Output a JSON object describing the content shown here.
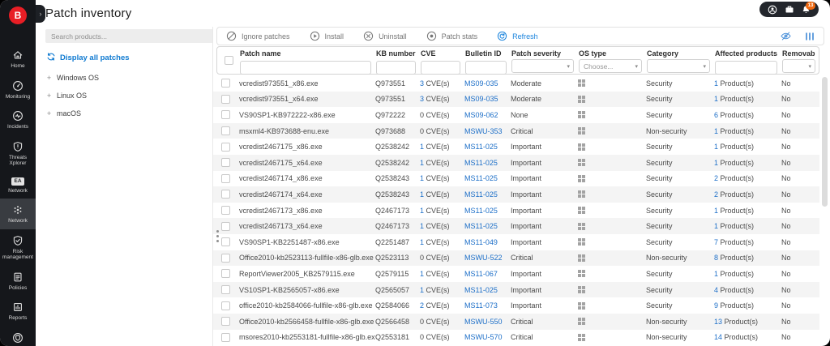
{
  "window": {
    "title": "Patch inventory"
  },
  "topbar": {
    "account_icons": [
      {
        "icon": "user-icon"
      },
      {
        "icon": "company-icon"
      },
      {
        "icon": "notifications-icon",
        "badge": "13"
      }
    ]
  },
  "sidebar": {
    "items": [
      {
        "label": "Home",
        "icon": "home-icon",
        "selected": false
      },
      {
        "label": "Monitoring",
        "icon": "monitoring-icon",
        "selected": false
      },
      {
        "label": "Incidents",
        "icon": "incidents-icon",
        "selected": false
      },
      {
        "label": "Threats Xplorer",
        "icon": "threats-xplorer-icon",
        "selected": false
      },
      {
        "label": "Network",
        "icon": "network-ea-icon",
        "selected": false
      },
      {
        "label": "Network",
        "icon": "network-icon",
        "selected": true
      },
      {
        "label": "Risk management",
        "icon": "risk-management-icon",
        "selected": false
      },
      {
        "label": "Policies",
        "icon": "policies-icon",
        "selected": false
      },
      {
        "label": "Reports",
        "icon": "reports-icon",
        "selected": false
      },
      {
        "label": "",
        "icon": "sandbox-icon",
        "selected": false
      }
    ]
  },
  "left_panel": {
    "search_placeholder": "Search products...",
    "display_all_label": "Display all patches",
    "tree": [
      {
        "label": "Windows OS"
      },
      {
        "label": "Linux OS"
      },
      {
        "label": "macOS"
      }
    ]
  },
  "toolbar": {
    "buttons": [
      {
        "label": "Ignore patches",
        "icon": "ignore-patches-icon",
        "accent": false
      },
      {
        "label": "Install",
        "icon": "install-icon",
        "accent": false
      },
      {
        "label": "Uninstall",
        "icon": "uninstall-icon",
        "accent": false
      },
      {
        "label": "Patch stats",
        "icon": "patch-stats-icon",
        "accent": false
      },
      {
        "label": "Refresh",
        "icon": "refresh-icon",
        "accent": true
      }
    ],
    "right_icons": [
      {
        "icon": "hide-columns-icon"
      },
      {
        "icon": "columns-icon"
      }
    ]
  },
  "table": {
    "columns": [
      {
        "label": "Patch name",
        "filter": "text",
        "placeholder": ""
      },
      {
        "label": "KB number",
        "filter": "text",
        "placeholder": ""
      },
      {
        "label": "CVE",
        "filter": "text",
        "placeholder": ""
      },
      {
        "label": "Bulletin ID",
        "filter": "text",
        "placeholder": ""
      },
      {
        "label": "Patch severity",
        "filter": "select",
        "placeholder": ""
      },
      {
        "label": "OS type",
        "filter": "select",
        "placeholder": "Choose..."
      },
      {
        "label": "Category",
        "filter": "select",
        "placeholder": ""
      },
      {
        "label": "Affected products",
        "filter": "text",
        "placeholder": ""
      },
      {
        "label": "Removable",
        "filter": "select",
        "placeholder": ""
      }
    ],
    "cve_suffix": "CVE(s)",
    "products_suffix": "Product(s)",
    "rows": [
      {
        "name": "vcredist973551_x86.exe",
        "kb": "Q973551",
        "cve": 3,
        "bulletin": "MS09-035",
        "severity": "Moderate",
        "os": "windows-icon",
        "category": "Security",
        "products": 1,
        "removable": "No"
      },
      {
        "name": "vcredist973551_x64.exe",
        "kb": "Q973551",
        "cve": 3,
        "bulletin": "MS09-035",
        "severity": "Moderate",
        "os": "windows-icon",
        "category": "Security",
        "products": 1,
        "removable": "No"
      },
      {
        "name": "VS90SP1-KB972222-x86.exe",
        "kb": "Q972222",
        "cve": 0,
        "bulletin": "MS09-062",
        "severity": "None",
        "os": "windows-icon",
        "category": "Security",
        "products": 6,
        "removable": "No"
      },
      {
        "name": "msxml4-KB973688-enu.exe",
        "kb": "Q973688",
        "cve": 0,
        "bulletin": "MSWU-353",
        "severity": "Critical",
        "os": "windows-icon",
        "category": "Non-security",
        "products": 1,
        "removable": "No"
      },
      {
        "name": "vcredist2467175_x86.exe",
        "kb": "Q2538242",
        "cve": 1,
        "bulletin": "MS11-025",
        "severity": "Important",
        "os": "windows-icon",
        "category": "Security",
        "products": 1,
        "removable": "No"
      },
      {
        "name": "vcredist2467175_x64.exe",
        "kb": "Q2538242",
        "cve": 1,
        "bulletin": "MS11-025",
        "severity": "Important",
        "os": "windows-icon",
        "category": "Security",
        "products": 1,
        "removable": "No"
      },
      {
        "name": "vcredist2467174_x86.exe",
        "kb": "Q2538243",
        "cve": 1,
        "bulletin": "MS11-025",
        "severity": "Important",
        "os": "windows-icon",
        "category": "Security",
        "products": 2,
        "removable": "No"
      },
      {
        "name": "vcredist2467174_x64.exe",
        "kb": "Q2538243",
        "cve": 1,
        "bulletin": "MS11-025",
        "severity": "Important",
        "os": "windows-icon",
        "category": "Security",
        "products": 2,
        "removable": "No"
      },
      {
        "name": "vcredist2467173_x86.exe",
        "kb": "Q2467173",
        "cve": 1,
        "bulletin": "MS11-025",
        "severity": "Important",
        "os": "windows-icon",
        "category": "Security",
        "products": 1,
        "removable": "No"
      },
      {
        "name": "vcredist2467173_x64.exe",
        "kb": "Q2467173",
        "cve": 1,
        "bulletin": "MS11-025",
        "severity": "Important",
        "os": "windows-icon",
        "category": "Security",
        "products": 1,
        "removable": "No"
      },
      {
        "name": "VS90SP1-KB2251487-x86.exe",
        "kb": "Q2251487",
        "cve": 1,
        "bulletin": "MS11-049",
        "severity": "Important",
        "os": "windows-icon",
        "category": "Security",
        "products": 7,
        "removable": "No"
      },
      {
        "name": "Office2010-kb2523113-fullfile-x86-glb.exe",
        "kb": "Q2523113",
        "cve": 0,
        "bulletin": "MSWU-522",
        "severity": "Critical",
        "os": "windows-icon",
        "category": "Non-security",
        "products": 8,
        "removable": "No"
      },
      {
        "name": "ReportViewer2005_KB2579115.exe",
        "kb": "Q2579115",
        "cve": 1,
        "bulletin": "MS11-067",
        "severity": "Important",
        "os": "windows-icon",
        "category": "Security",
        "products": 1,
        "removable": "No"
      },
      {
        "name": "VS10SP1-KB2565057-x86.exe",
        "kb": "Q2565057",
        "cve": 1,
        "bulletin": "MS11-025",
        "severity": "Important",
        "os": "windows-icon",
        "category": "Security",
        "products": 4,
        "removable": "No"
      },
      {
        "name": "office2010-kb2584066-fullfile-x86-glb.exe",
        "kb": "Q2584066",
        "cve": 2,
        "bulletin": "MS11-073",
        "severity": "Important",
        "os": "windows-icon",
        "category": "Security",
        "products": 9,
        "removable": "No"
      },
      {
        "name": "Office2010-kb2566458-fullfile-x86-glb.exe",
        "kb": "Q2566458",
        "cve": 0,
        "bulletin": "MSWU-550",
        "severity": "Critical",
        "os": "windows-icon",
        "category": "Non-security",
        "products": 13,
        "removable": "No"
      },
      {
        "name": "msores2010-kb2553181-fullfile-x86-glb.exe",
        "kb": "Q2553181",
        "cve": 0,
        "bulletin": "MSWU-570",
        "severity": "Critical",
        "os": "windows-icon",
        "category": "Non-security",
        "products": 14,
        "removable": "No"
      }
    ]
  },
  "colors": {
    "accent": "#1b84dd",
    "link": "#1d6fc8",
    "logo_red": "#e81e25",
    "badge_orange": "#f06a12",
    "sidebar_bg": "#15171b",
    "sidebar_selected_bg": "#393c41",
    "row_alt": "#f4f4f4"
  }
}
